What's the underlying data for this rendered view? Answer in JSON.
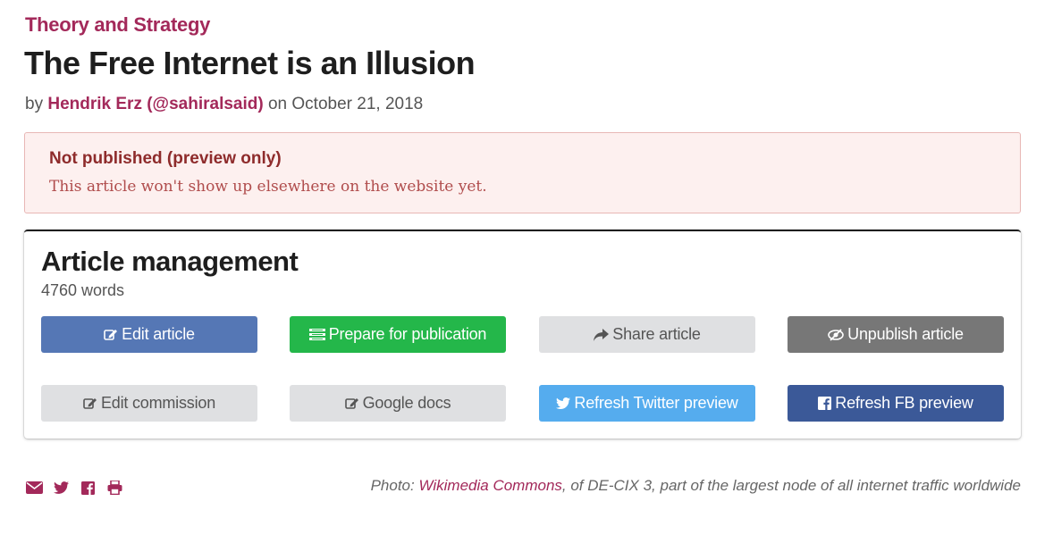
{
  "article": {
    "category": "Theory and Strategy",
    "title": "The Free Internet is an Illusion",
    "byline_prefix": "by",
    "author": "Hendrik Erz",
    "handle": "(@sahiralsaid)",
    "date_prefix": "on",
    "date": "October 21, 2018"
  },
  "alert": {
    "title": "Not published (preview only)",
    "text": "This article won't show up elsewhere on the website yet."
  },
  "management": {
    "title": "Article management",
    "word_count": "4760 words",
    "buttons": {
      "edit_article": "Edit article",
      "prepare": "Prepare for publication",
      "share": "Share article",
      "unpublish": "Unpublish article",
      "edit_commission": "Edit commission",
      "google_docs": "Google docs",
      "refresh_twitter": "Refresh Twitter preview",
      "refresh_fb": "Refresh FB preview"
    }
  },
  "caption": {
    "prefix": "Photo:",
    "link": "Wikimedia Commons",
    "suffix": ", of DE-CIX 3, part of the largest node of all internet traffic worldwide"
  },
  "share_icons": [
    "envelope-icon",
    "twitter-icon",
    "facebook-icon",
    "print-icon"
  ],
  "colors": {
    "accent": "#a3295a",
    "edit_blue": "#5577b5",
    "publish_green": "#24b74a",
    "twitter_blue": "#55acee",
    "facebook_blue": "#3b5998",
    "unpublish_gray": "#777777",
    "alert_bg": "#fdf0ef"
  }
}
